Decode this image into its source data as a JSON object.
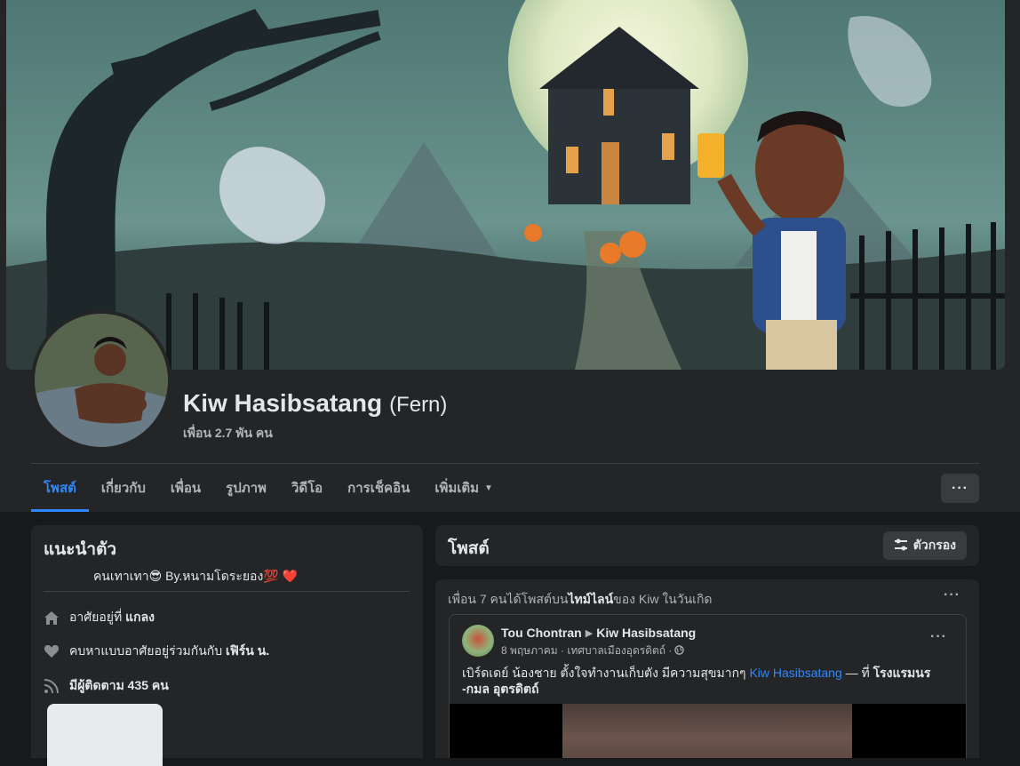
{
  "profile": {
    "name": "Kiw Hasibsatang",
    "alt_name": "(Fern)",
    "friends_count": "เพื่อน 2.7 พัน คน"
  },
  "tabs": [
    {
      "label": "โพสต์",
      "active": true
    },
    {
      "label": "เกี่ยวกับ"
    },
    {
      "label": "เพื่อน"
    },
    {
      "label": "รูปภาพ"
    },
    {
      "label": "วิดีโอ"
    },
    {
      "label": "การเช็คอิน"
    },
    {
      "label": "เพิ่มเติม"
    }
  ],
  "tabs_more_icon": "ellipsis-icon",
  "intro": {
    "title": "แนะนำตัว",
    "bio": "คนเทาเทา😎 By.หนามโดระยอง💯 ❤️",
    "lives_prefix": "อาศัยอยู่ที่",
    "lives_place": "แกลง",
    "relationship_prefix": "คบหาแบบอาศัยอยู่ร่วมกันกับ",
    "relationship_partner": "เฟิร์น น.",
    "followers": "มีผู้ติดตาม 435 คน"
  },
  "posts_header": {
    "title": "โพสต์",
    "filter_label": "ตัวกรอง"
  },
  "feed": {
    "summary_prefix": "เพื่อน 7 คนได้โพสต์บน",
    "summary_bold": "ไทม์ไลน์",
    "summary_suffix": "ของ Kiw ในวันเกิด",
    "post": {
      "author": "Tou Chontran",
      "target": "Kiw Hasibsatang",
      "meta": "8 พฤษภาคม · เทศบาลเมืองอุดรดิตถ์ ·",
      "text_before": "เบิร์ดเดย์ น้องชาย ตั้งใจทำงานเก็บตัง มีความสุขมากๆ",
      "text_link": "Kiw Hasibsatang",
      "text_middle": "— ที่",
      "text_place": "โรงแรมนร -กมล อุตรดิตถ์"
    }
  },
  "colors": {
    "accent": "#2d88ff",
    "background": "#18191a",
    "card": "#242526"
  }
}
